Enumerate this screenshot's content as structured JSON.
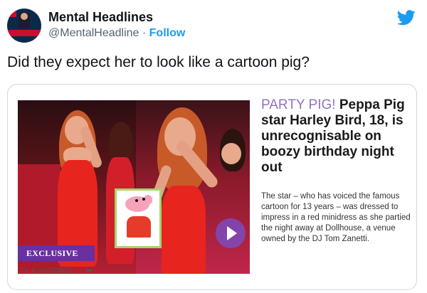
{
  "tweet": {
    "account_name": "Mental Headlines",
    "handle": "@MentalHeadline",
    "separator": "·",
    "follow_label": "Follow",
    "text": "Did they expect her to look like a cartoon pig?"
  },
  "card": {
    "kicker": "PARTY PIG!",
    "headline": "Peppa Pig star Harley Bird, 18, is unrecognisable on boozy birthday night out",
    "summary": "The star – who has voiced the famous cartoon for 13 years – was dressed to impress in a red minidress as she partied the night away at Dollhouse, a venue owned by the DJ Tom Zanetti.",
    "badge": "EXCLUSIVE",
    "category": "TV & SHOWBIZ>"
  },
  "icons": {
    "twitter": "twitter-bird-icon",
    "share": "share-arrow-icon",
    "play": "play-icon"
  },
  "colors": {
    "twitter_blue": "#1d9bf0",
    "kicker": "#8f73c7",
    "badge": "#6a2fa0"
  }
}
